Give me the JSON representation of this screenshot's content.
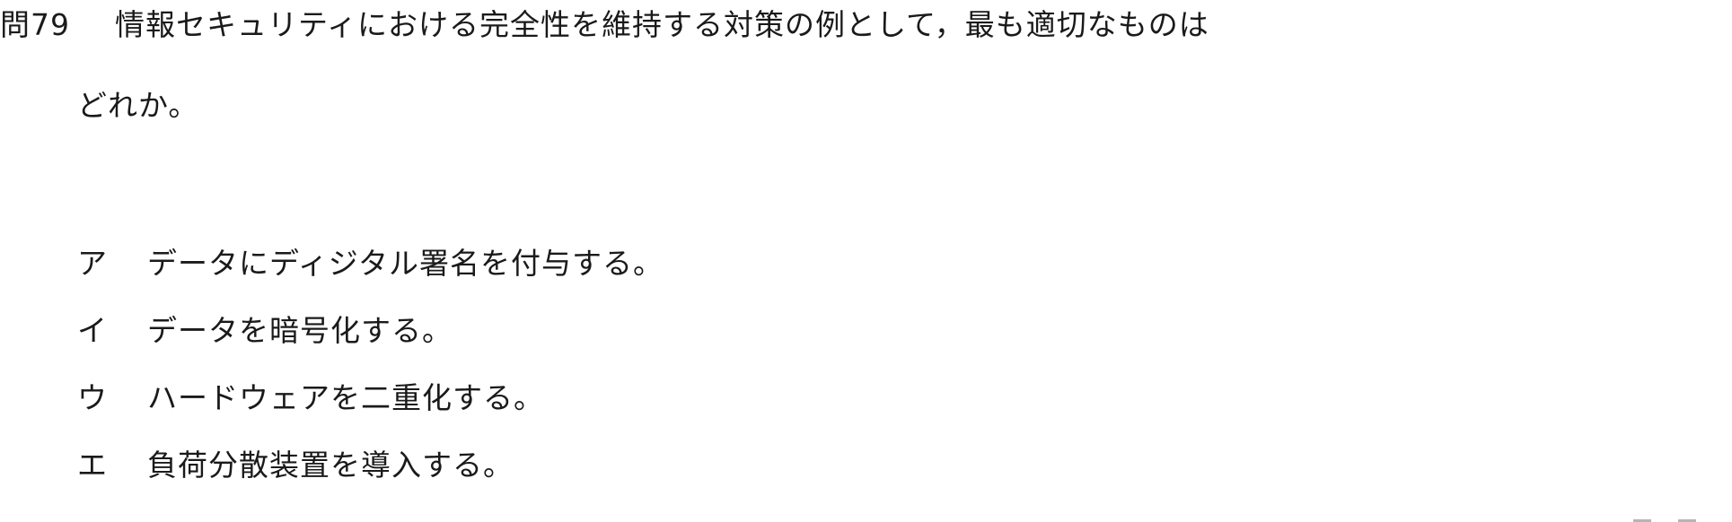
{
  "question": {
    "number": "問79",
    "text_line1": "情報セキュリティにおける完全性を維持する対策の例として，最も適切なものは",
    "text_line2": "どれか。"
  },
  "choices": [
    {
      "label": "ア",
      "text": "データにディジタル署名を付与する。"
    },
    {
      "label": "イ",
      "text": "データを暗号化する。"
    },
    {
      "label": "ウ",
      "text": "ハードウェアを二重化する。"
    },
    {
      "label": "エ",
      "text": "負荷分散装置を導入する。"
    }
  ]
}
